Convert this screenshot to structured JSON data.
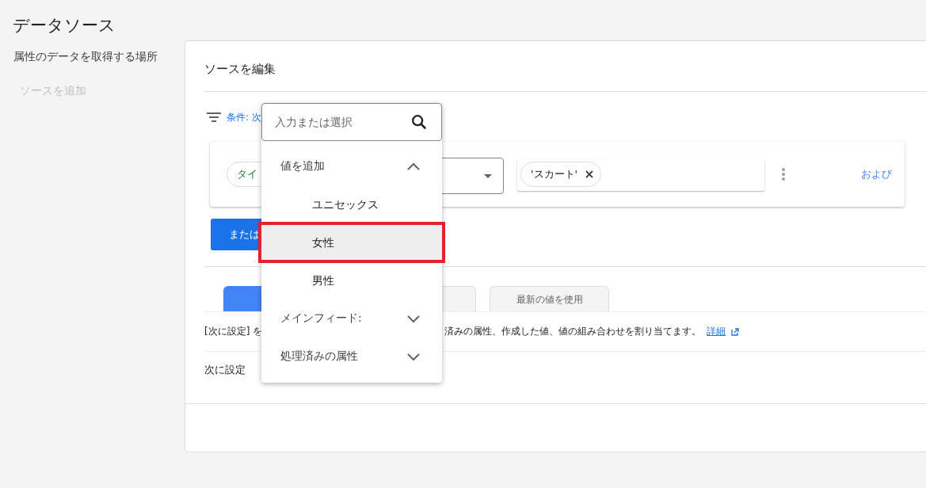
{
  "page": {
    "title": "データソース"
  },
  "sidebar": {
    "heading": "属性のデータを取得する場所",
    "items": [
      {
        "label": "ソースを追加",
        "disabled": true
      }
    ]
  },
  "editor": {
    "title": "ソースを編集",
    "filter_label": "条件: 次",
    "condition": {
      "attribute_chip": "タイ",
      "values": [
        "'スカート'"
      ],
      "and_link": "および"
    },
    "or_button": "または",
    "tabs": [
      {
        "selected": true
      },
      {
        "selected": false
      },
      {
        "label": "最新の値を使用",
        "selected": false
      }
    ],
    "description_start": "[次に設定] を",
    "description_end": "済みの属性、作成した値、値の組み合わせを割り当てます。",
    "details_link": "詳細",
    "set_to_label": "次に設定"
  },
  "dropdown": {
    "placeholder": "入力または選択",
    "groups": [
      {
        "label": "値を追加",
        "expanded": true,
        "options": [
          {
            "label": "ユニセックス",
            "selected": false
          },
          {
            "label": "女性",
            "selected": true
          },
          {
            "label": "男性",
            "selected": false
          }
        ]
      },
      {
        "label": "メインフィード:",
        "expanded": false
      },
      {
        "label": "処理済みの属性",
        "expanded": false
      }
    ]
  }
}
